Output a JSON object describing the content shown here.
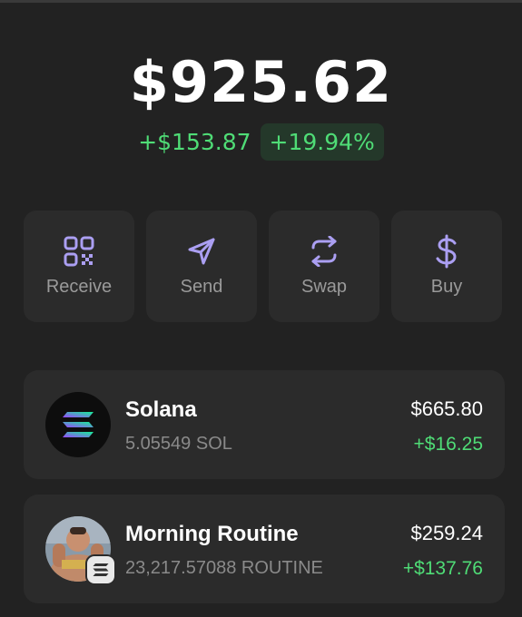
{
  "balance": {
    "total": "$925.62",
    "change_amount": "+$153.87",
    "change_percent": "+19.94%"
  },
  "actions": [
    {
      "label": "Receive",
      "icon": "qr-code-icon"
    },
    {
      "label": "Send",
      "icon": "send-icon"
    },
    {
      "label": "Swap",
      "icon": "swap-icon"
    },
    {
      "label": "Buy",
      "icon": "dollar-icon"
    }
  ],
  "tokens": [
    {
      "name": "Solana",
      "amount": "5.05549 SOL",
      "value": "$665.80",
      "change": "+$16.25",
      "icon": "solana-logo-icon"
    },
    {
      "name": "Morning Routine",
      "amount": "23,217.57088 ROUTINE",
      "value": "$259.24",
      "change": "+$137.76",
      "icon": "token-avatar"
    }
  ],
  "colors": {
    "background": "#222222",
    "card": "#2b2b2b",
    "accent": "#ab9ff2",
    "positive": "#4fdc76",
    "muted": "#9a9a9a"
  }
}
